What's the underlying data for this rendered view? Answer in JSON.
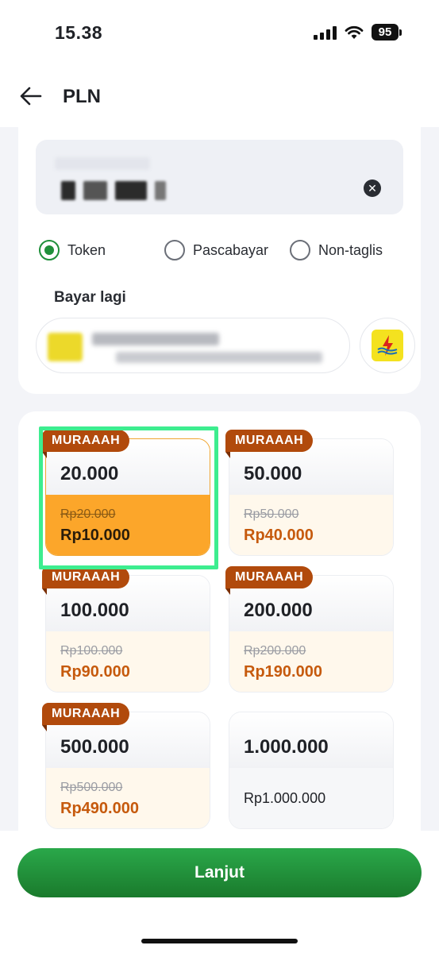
{
  "status_bar": {
    "time": "15.38",
    "battery": "95",
    "icons": [
      "signal-icon",
      "wifi-icon",
      "battery-icon"
    ]
  },
  "header": {
    "title": "PLN",
    "back_icon": "arrow-left-icon"
  },
  "meter_input": {
    "clear_icon": "close-icon"
  },
  "product_types": {
    "options": [
      {
        "label": "Token",
        "selected": true
      },
      {
        "label": "Pascabayar",
        "selected": false
      },
      {
        "label": "Non-taglis",
        "selected": false
      }
    ]
  },
  "history": {
    "title": "Bayar lagi"
  },
  "denominations": [
    {
      "badge": "MURAAAH",
      "amount": "20.000",
      "old_price": "Rp20.000",
      "price": "Rp10.000",
      "selected": true
    },
    {
      "badge": "MURAAAH",
      "amount": "50.000",
      "old_price": "Rp50.000",
      "price": "Rp40.000",
      "selected": false
    },
    {
      "badge": "MURAAAH",
      "amount": "100.000",
      "old_price": "Rp100.000",
      "price": "Rp90.000",
      "selected": false
    },
    {
      "badge": "MURAAAH",
      "amount": "200.000",
      "old_price": "Rp200.000",
      "price": "Rp190.000",
      "selected": false
    },
    {
      "badge": "MURAAAH",
      "amount": "500.000",
      "old_price": "Rp500.000",
      "price": "Rp490.000",
      "selected": false
    },
    {
      "badge": "",
      "amount": "1.000.000",
      "old_price": "",
      "price": "Rp1.000.000",
      "selected": false
    }
  ],
  "actions": {
    "continue_label": "Lanjut"
  },
  "colors": {
    "primary_green": "#1f8f3a",
    "promo_badge": "#b14a0c",
    "selected_fill": "#fca62a",
    "highlight_frame": "#3ded8f"
  }
}
